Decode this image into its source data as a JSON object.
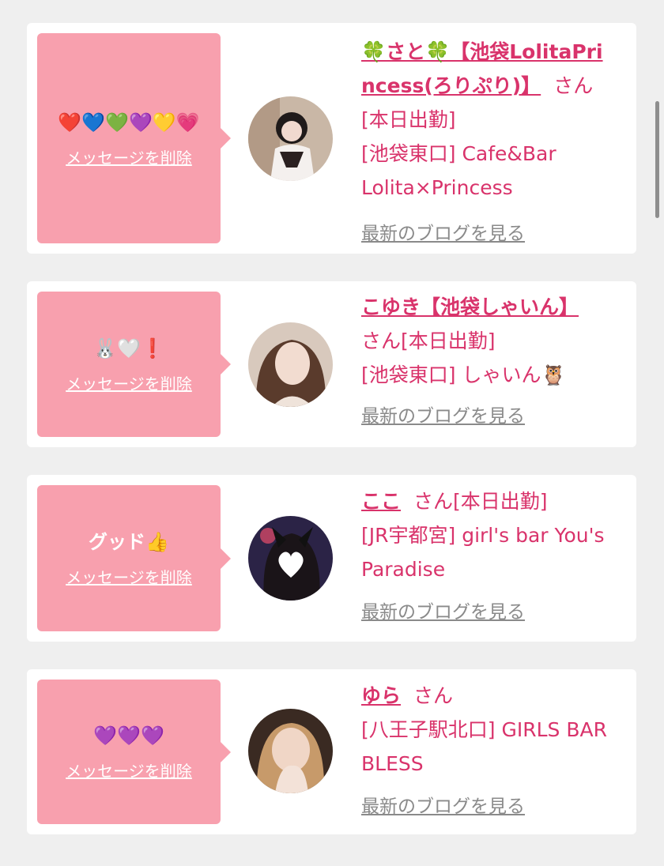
{
  "theme": {
    "accent": "#d9336b",
    "bubble": "#f8a0ae",
    "link_gray": "#8a8a8a",
    "background": "#efefef"
  },
  "cards": [
    {
      "message": "❤️💙💚💜💛💗",
      "delete_label": "メッセージを削除",
      "name": "🍀さと🍀【池袋LolitaPrincess(ろりぷり)】",
      "honorific": "さん",
      "status": "[本日出勤]",
      "shop": "[池袋東口] Cafe&Bar Lolita×Princess",
      "blog_label": "最新のブログを見る"
    },
    {
      "message": "🐰🤍❗️",
      "delete_label": "メッセージを削除",
      "name": "こゆき【池袋しゃいん】",
      "honorific": "さん",
      "status": "[本日出勤]",
      "shop": "[池袋東口] しゃいん🦉",
      "blog_label": "最新のブログを見る"
    },
    {
      "message": "グッド👍",
      "delete_label": "メッセージを削除",
      "name": "ここ",
      "honorific": "さん",
      "status": "[本日出勤]",
      "shop": "[JR宇都宮] girl's bar You's Paradise",
      "blog_label": "最新のブログを見る"
    },
    {
      "message": "💜💜💜",
      "delete_label": "メッセージを削除",
      "name": "ゆら",
      "honorific": "さん",
      "status": "",
      "shop": "[八王子駅北口] GIRLS BAR BLESS",
      "blog_label": "最新のブログを見る"
    }
  ]
}
